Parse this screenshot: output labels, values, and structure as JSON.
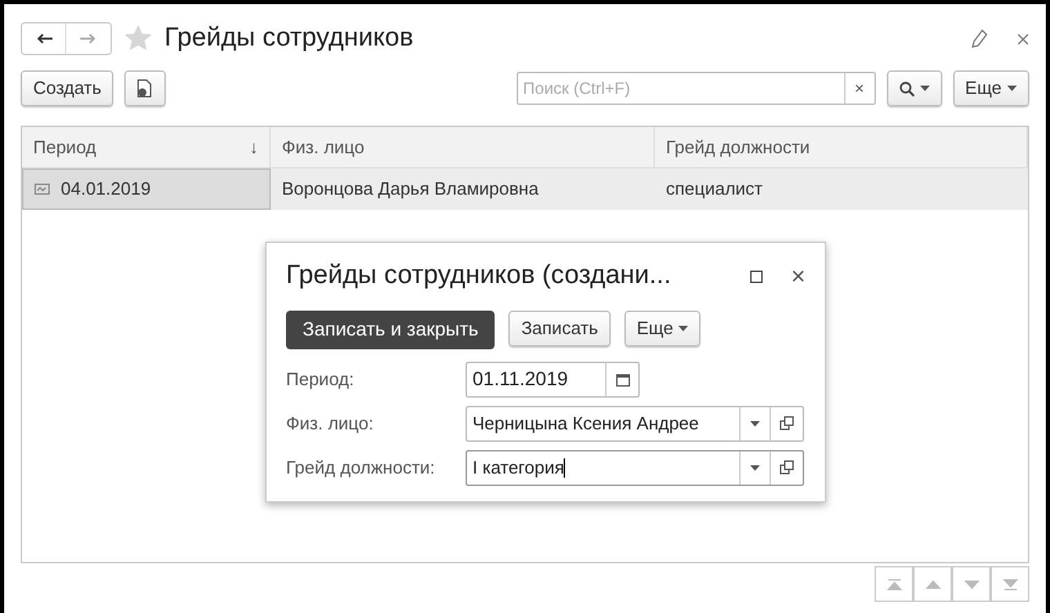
{
  "window": {
    "title": "Грейды сотрудников",
    "favorite": false
  },
  "toolbar": {
    "create": "Создать",
    "search": {
      "placeholder": "Поиск (Ctrl+F)",
      "clear": "×"
    },
    "more": "Еще"
  },
  "table": {
    "columns": [
      {
        "label": "Период",
        "sort": "↓"
      },
      {
        "label": "Физ. лицо"
      },
      {
        "label": "Грейд должности"
      }
    ],
    "rows": [
      {
        "selected": true,
        "cells": [
          "04.01.2019",
          "Воронцова Дарья Вламировна",
          "специалист"
        ]
      }
    ]
  },
  "dialog": {
    "title": "Грейды сотрудников (создани...",
    "close": "×",
    "buttons": [
      {
        "kind": "primary",
        "label": "Записать и закрыть"
      },
      {
        "kind": "plain",
        "label": "Записать"
      },
      {
        "kind": "menu",
        "label": "Еще"
      }
    ],
    "fields": [
      {
        "kind": "date",
        "label": "Период:",
        "value": "01.11.2019",
        "focused": false
      },
      {
        "kind": "ref",
        "label": "Физ. лицо:",
        "value": "Черницына Ксения Андрее",
        "focused": false
      },
      {
        "kind": "ref",
        "label": "Грейд должности:",
        "value": "I категория",
        "focused": true
      }
    ]
  }
}
